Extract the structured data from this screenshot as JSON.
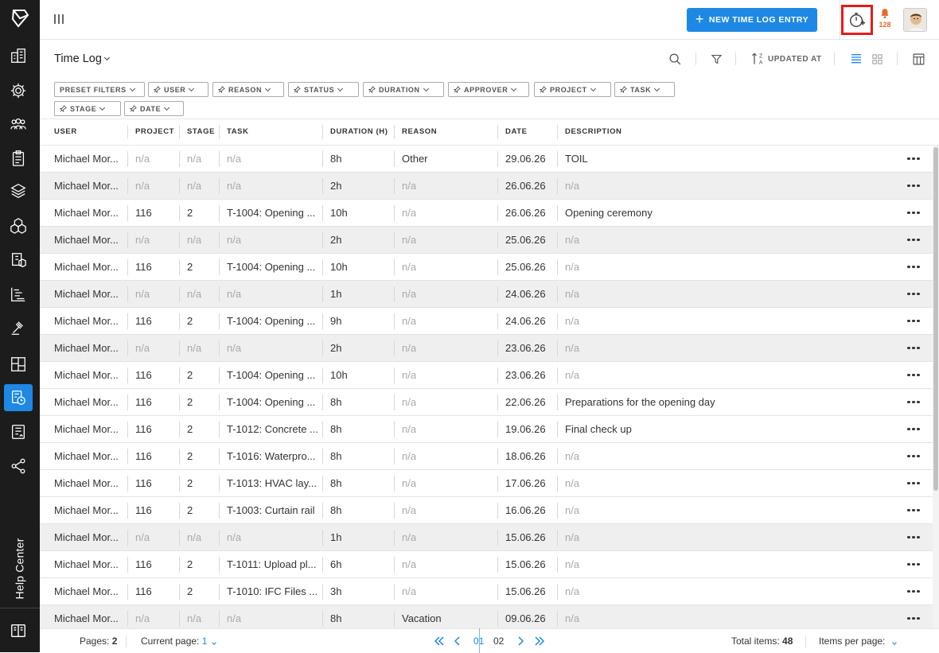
{
  "sidebar": {
    "help_center": "Help Center",
    "items": [
      "buildings-icon",
      "settings-gear-icon",
      "team-icon",
      "clipboard-icon",
      "layers-icon",
      "cubes-icon",
      "documents-box-icon",
      "gantt-icon",
      "gavel-icon",
      "layout-icon",
      "time-log-icon",
      "contract-icon",
      "share-icon"
    ],
    "active_item": "time-log-icon"
  },
  "header": {
    "new_entry_label": "NEW TIME LOG ENTRY",
    "notification_count": "128"
  },
  "toolbar": {
    "title": "Time Log",
    "sort_label": "UPDATED AT"
  },
  "filters": [
    "PRESET FILTERS",
    "USER",
    "REASON",
    "STATUS",
    "DURATION",
    "APPROVER",
    "PROJECT",
    "TASK",
    "STAGE",
    "DATE"
  ],
  "table": {
    "columns": [
      "USER",
      "PROJECT",
      "STAGE",
      "TASK",
      "DURATION (H)",
      "REASON",
      "DATE",
      "DESCRIPTION"
    ],
    "rows": [
      {
        "user": "Michael Mor...",
        "project": "n/a",
        "stage": "n/a",
        "task": "n/a",
        "duration": "8h",
        "reason": "Other",
        "date": "29.06.26",
        "description": "TOIL"
      },
      {
        "user": "Michael Mor...",
        "project": "n/a",
        "stage": "n/a",
        "task": "n/a",
        "duration": "2h",
        "reason": "n/a",
        "date": "26.06.26",
        "description": "n/a"
      },
      {
        "user": "Michael Mor...",
        "project": "116",
        "stage": "2",
        "task": "T-1004: Opening ...",
        "duration": "10h",
        "reason": "n/a",
        "date": "26.06.26",
        "description": "Opening ceremony"
      },
      {
        "user": "Michael Mor...",
        "project": "n/a",
        "stage": "n/a",
        "task": "n/a",
        "duration": "2h",
        "reason": "n/a",
        "date": "25.06.26",
        "description": "n/a"
      },
      {
        "user": "Michael Mor...",
        "project": "116",
        "stage": "2",
        "task": "T-1004: Opening ...",
        "duration": "10h",
        "reason": "n/a",
        "date": "25.06.26",
        "description": "n/a"
      },
      {
        "user": "Michael Mor...",
        "project": "n/a",
        "stage": "n/a",
        "task": "n/a",
        "duration": "1h",
        "reason": "n/a",
        "date": "24.06.26",
        "description": "n/a"
      },
      {
        "user": "Michael Mor...",
        "project": "116",
        "stage": "2",
        "task": "T-1004: Opening ...",
        "duration": "9h",
        "reason": "n/a",
        "date": "24.06.26",
        "description": "n/a"
      },
      {
        "user": "Michael Mor...",
        "project": "n/a",
        "stage": "n/a",
        "task": "n/a",
        "duration": "2h",
        "reason": "n/a",
        "date": "23.06.26",
        "description": "n/a"
      },
      {
        "user": "Michael Mor...",
        "project": "116",
        "stage": "2",
        "task": "T-1004: Opening ...",
        "duration": "10h",
        "reason": "n/a",
        "date": "23.06.26",
        "description": "n/a"
      },
      {
        "user": "Michael Mor...",
        "project": "116",
        "stage": "2",
        "task": "T-1004: Opening ...",
        "duration": "8h",
        "reason": "n/a",
        "date": "22.06.26",
        "description": "Preparations for the opening day"
      },
      {
        "user": "Michael Mor...",
        "project": "116",
        "stage": "2",
        "task": "T-1012: Concrete ...",
        "duration": "8h",
        "reason": "n/a",
        "date": "19.06.26",
        "description": "Final check up"
      },
      {
        "user": "Michael Mor...",
        "project": "116",
        "stage": "2",
        "task": "T-1016: Waterpro...",
        "duration": "8h",
        "reason": "n/a",
        "date": "18.06.26",
        "description": "n/a"
      },
      {
        "user": "Michael Mor...",
        "project": "116",
        "stage": "2",
        "task": "T-1013: HVAC lay...",
        "duration": "8h",
        "reason": "n/a",
        "date": "17.06.26",
        "description": "n/a"
      },
      {
        "user": "Michael Mor...",
        "project": "116",
        "stage": "2",
        "task": "T-1003: Curtain rail",
        "duration": "8h",
        "reason": "n/a",
        "date": "16.06.26",
        "description": "n/a"
      },
      {
        "user": "Michael Mor...",
        "project": "n/a",
        "stage": "n/a",
        "task": "n/a",
        "duration": "1h",
        "reason": "n/a",
        "date": "15.06.26",
        "description": "n/a"
      },
      {
        "user": "Michael Mor...",
        "project": "116",
        "stage": "2",
        "task": "T-1011: Upload pl...",
        "duration": "6h",
        "reason": "n/a",
        "date": "15.06.26",
        "description": "n/a"
      },
      {
        "user": "Michael Mor...",
        "project": "116",
        "stage": "2",
        "task": "T-1010: IFC Files ...",
        "duration": "3h",
        "reason": "n/a",
        "date": "15.06.26",
        "description": "n/a"
      },
      {
        "user": "Michael Mor...",
        "project": "n/a",
        "stage": "n/a",
        "task": "n/a",
        "duration": "8h",
        "reason": "Vacation",
        "date": "09.06.26",
        "description": "n/a"
      }
    ]
  },
  "footer": {
    "pages_label": "Pages:",
    "pages_value": "2",
    "current_page_label": "Current page:",
    "current_page_value": "1",
    "page_numbers": [
      "01",
      "02"
    ],
    "current_page_number": "01",
    "total_items_label": "Total items:",
    "total_items_value": "48",
    "items_per_page_label": "Items per page:"
  },
  "colors": {
    "accent": "#1e88e5",
    "sidebar_bg": "#1c1c1c",
    "highlight_box": "#e41b1b",
    "notification": "#e46a2a"
  }
}
